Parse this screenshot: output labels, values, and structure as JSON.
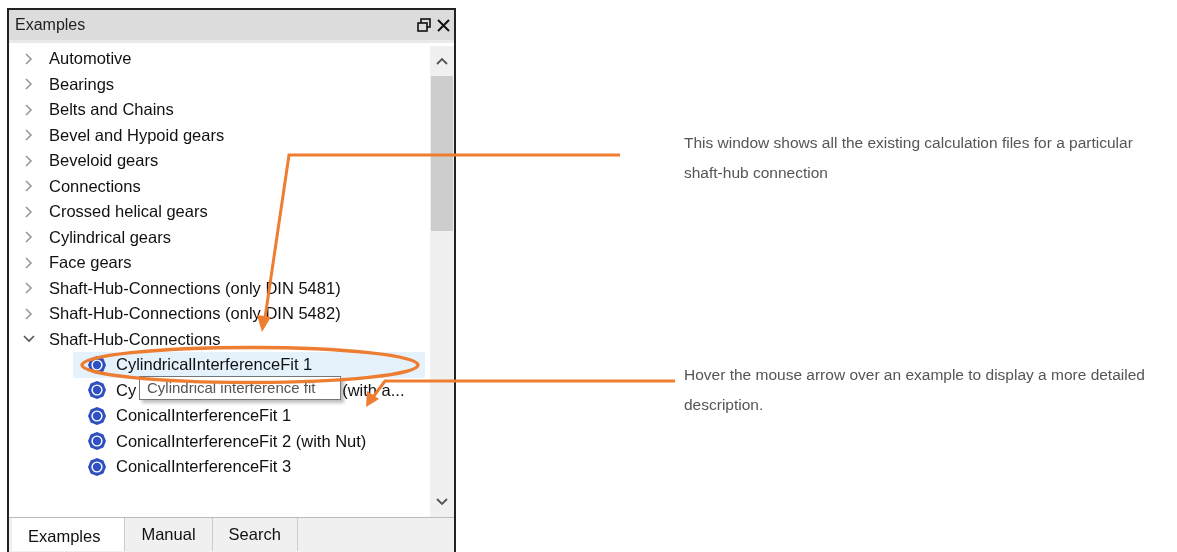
{
  "panel": {
    "title": "Examples"
  },
  "tree": [
    {
      "label": "Automotive",
      "expanded": false
    },
    {
      "label": "Bearings",
      "expanded": false
    },
    {
      "label": "Belts and Chains",
      "expanded": false
    },
    {
      "label": "Bevel and Hypoid gears",
      "expanded": false
    },
    {
      "label": "Beveloid gears",
      "expanded": false
    },
    {
      "label": "Connections",
      "expanded": false
    },
    {
      "label": "Crossed helical gears",
      "expanded": false
    },
    {
      "label": "Cylindrical gears",
      "expanded": false
    },
    {
      "label": "Face gears",
      "expanded": false
    },
    {
      "label": "Shaft-Hub-Connections (only DIN 5481)",
      "expanded": false
    },
    {
      "label": "Shaft-Hub-Connections (only DIN 5482)",
      "expanded": false
    },
    {
      "label": "Shaft-Hub-Connections",
      "expanded": true,
      "children": [
        {
          "label": "CylindricalInterferenceFit 1",
          "selected": true
        },
        {
          "label": "Cy",
          "label_end": "(with a...",
          "selected": false
        },
        {
          "label": "ConicalInterferenceFit 1",
          "selected": false
        },
        {
          "label": "ConicalInterferenceFit 2 (with Nut)",
          "selected": false
        },
        {
          "label": "ConicalInterferenceFit 3",
          "selected": false
        }
      ]
    }
  ],
  "tooltip": {
    "text": "Cylindrical interference fit"
  },
  "tabs": [
    {
      "label": "Examples",
      "selected": true
    },
    {
      "label": "Manual",
      "selected": false
    },
    {
      "label": "Search",
      "selected": false
    }
  ],
  "callouts": [
    {
      "text": "This window shows all the existing calculation files for a particular shaft-hub connection"
    },
    {
      "text": "Hover the mouse arrow over an example to display a more detailed description."
    }
  ]
}
